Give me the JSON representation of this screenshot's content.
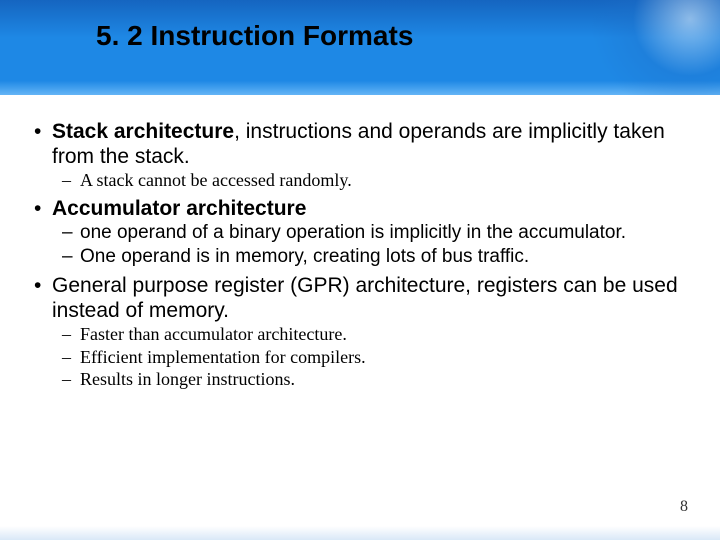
{
  "title": "5. 2 Instruction Formats",
  "bullets": {
    "b1_bold": "Stack architecture",
    "b1_rest": ", instructions and operands are implicitly taken from the stack.",
    "b1_sub1": "A stack cannot be accessed randomly.",
    "b2_bold": "Accumulator architecture",
    "b2_sub1": "one operand of a binary operation is implicitly in the accumulator.",
    "b2_sub2": "One operand is in memory, creating lots of bus traffic.",
    "b3": "General purpose register (GPR) architecture, registers can be used instead of memory.",
    "b3_sub1": "Faster than accumulator architecture.",
    "b3_sub2": "Efficient implementation for compilers.",
    "b3_sub3": "Results in longer instructions."
  },
  "page_number": "8"
}
